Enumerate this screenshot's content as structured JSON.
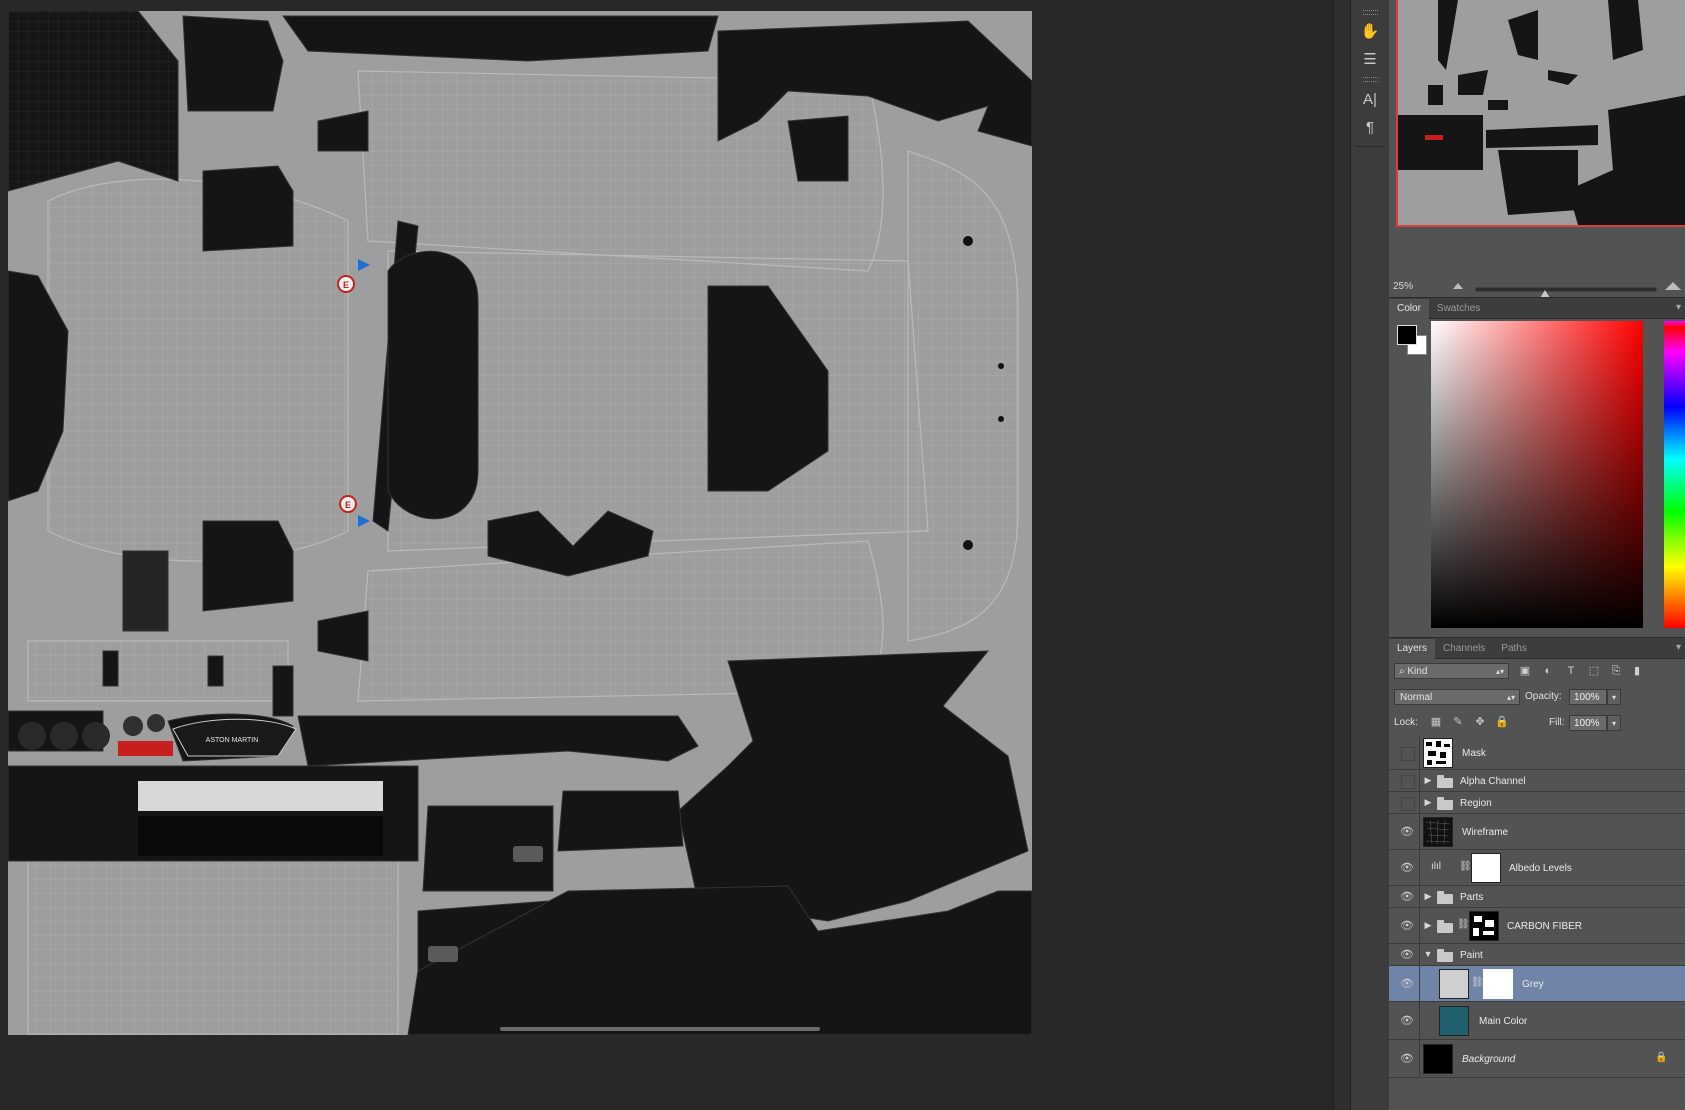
{
  "canvas": {
    "tex_colors": {
      "background": "#9e9e9e",
      "part": "#151515",
      "wire": "#b8b8b8"
    },
    "badge_letter": "E",
    "logo_text": "ASTON MARTIN"
  },
  "toolbar": {
    "tools": [
      {
        "name": "puppet-icon",
        "glyph": "✋"
      },
      {
        "name": "adjust-icon",
        "glyph": "☰"
      },
      {
        "name": "character-icon",
        "glyph": "A|"
      },
      {
        "name": "paragraph-icon",
        "glyph": "¶"
      }
    ]
  },
  "navigator": {
    "zoom": "25%"
  },
  "color_panel": {
    "tabs": [
      "Color",
      "Swatches"
    ],
    "foreground": "#000000",
    "background": "#ffffff",
    "hue": "#ff0000"
  },
  "layers_panel": {
    "tabs": [
      "Layers",
      "Channels",
      "Paths"
    ],
    "filter_kind": "Kind",
    "blend_mode": "Normal",
    "opacity_label": "Opacity:",
    "opacity": "100%",
    "lock_label": "Lock:",
    "fill_label": "Fill:",
    "fill": "100%",
    "layers": [
      {
        "name": "Mask",
        "visible": false,
        "type": "layer"
      },
      {
        "name": "Alpha Channel",
        "visible": false,
        "type": "group"
      },
      {
        "name": "Region",
        "visible": false,
        "type": "group"
      },
      {
        "name": "Wireframe",
        "visible": true,
        "type": "layer"
      },
      {
        "name": "Albedo Levels",
        "visible": true,
        "type": "adjustment"
      },
      {
        "name": "Parts",
        "visible": true,
        "type": "group"
      },
      {
        "name": "CARBON FIBER",
        "visible": true,
        "type": "group-masked"
      },
      {
        "name": "Paint",
        "visible": true,
        "type": "group-open"
      },
      {
        "name": "Grey",
        "visible": true,
        "type": "layer-masked",
        "selected": true
      },
      {
        "name": "Main Color",
        "visible": true,
        "type": "layer"
      },
      {
        "name": "Background",
        "visible": true,
        "type": "background",
        "locked": true
      }
    ],
    "colors": {
      "selected": "#7084a8",
      "main_color_swatch": "#1f5f6e"
    }
  }
}
